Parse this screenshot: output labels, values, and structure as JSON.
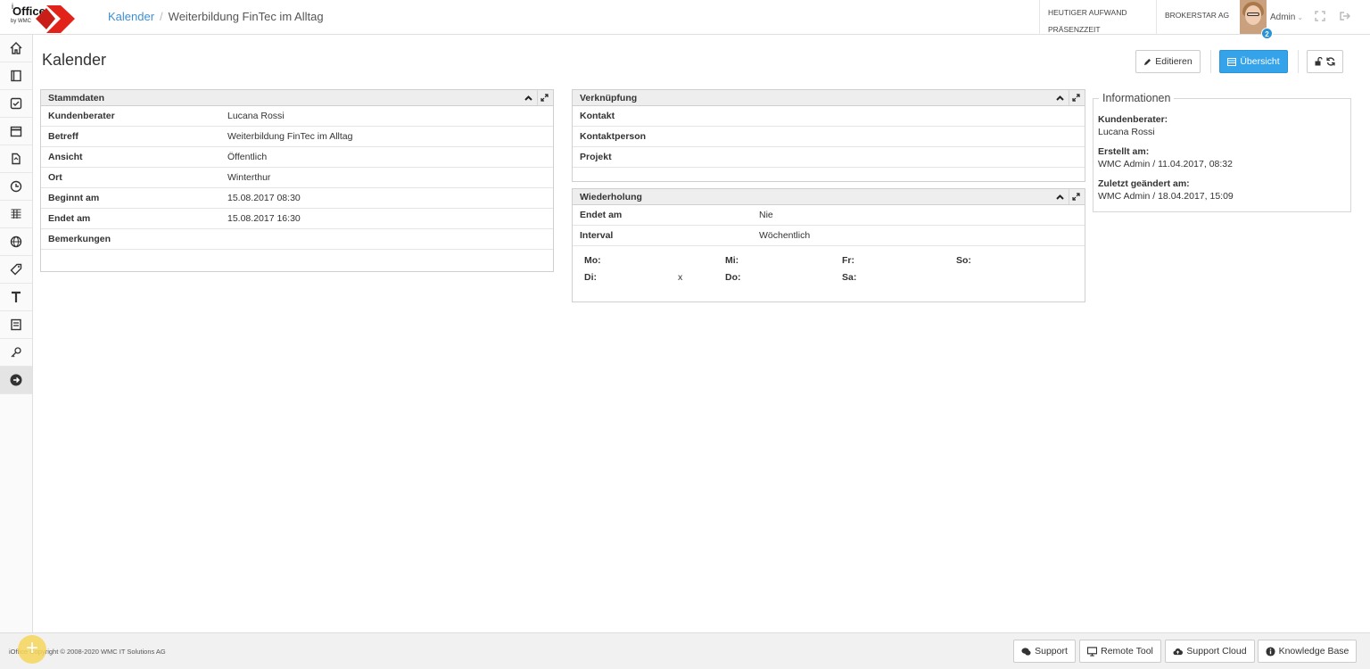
{
  "app": {
    "logo_word": "Office",
    "logo_i": "i",
    "logo_by": "by WMC"
  },
  "breadcrumb": {
    "parent": "Kalender",
    "current": "Weiterbildung FinTec im Alltag"
  },
  "top": {
    "stat1": "HEUTIGER AUFWAND",
    "stat2": "PRÄSENZZEIT",
    "company": "BROKERSTAR AG",
    "user": "Admin",
    "badge_count": "2"
  },
  "sidebar": {
    "items": [
      "home-icon",
      "book-icon",
      "checkbox-icon",
      "calendar-icon",
      "document-icon",
      "clock-icon",
      "table-icon",
      "globe-icon",
      "tag-icon",
      "text-icon",
      "form-icon",
      "key-icon",
      "arrow-right-icon"
    ],
    "active_index": 12
  },
  "page": {
    "title": "Kalender"
  },
  "toolbar": {
    "edit_label": "Editieren",
    "overview_label": "Übersicht"
  },
  "stammdaten": {
    "title": "Stammdaten",
    "rows": [
      {
        "k": "Kundenberater",
        "v": "Lucana Rossi"
      },
      {
        "k": "Betreff",
        "v": "Weiterbildung FinTec im Alltag"
      },
      {
        "k": "Ansicht",
        "v": "Öffentlich"
      },
      {
        "k": "Ort",
        "v": "Winterthur"
      },
      {
        "k": "Beginnt am",
        "v": "15.08.2017 08:30"
      },
      {
        "k": "Endet am",
        "v": "15.08.2017 16:30"
      },
      {
        "k": "Bemerkungen",
        "v": ""
      }
    ]
  },
  "verknuepfung": {
    "title": "Verknüpfung",
    "rows": [
      {
        "k": "Kontakt"
      },
      {
        "k": "Kontaktperson"
      },
      {
        "k": "Projekt"
      }
    ]
  },
  "wiederholung": {
    "title": "Wiederholung",
    "rows": [
      {
        "k": "Endet am",
        "v": "Nie"
      },
      {
        "k": "Interval",
        "v": "Wöchentlich"
      }
    ],
    "days": {
      "mo": "Mo:",
      "mo_v": "",
      "di": "Di:",
      "di_v": "x",
      "mi": "Mi:",
      "mi_v": "",
      "do": "Do:",
      "do_v": "",
      "fr": "Fr:",
      "fr_v": "",
      "sa": "Sa:",
      "sa_v": "",
      "so": "So:",
      "so_v": ""
    }
  },
  "informationen": {
    "title": "Informationen",
    "berater_label": "Kundenberater:",
    "berater_value": "Lucana Rossi",
    "erstellt_label": "Erstellt am:",
    "erstellt_value": "WMC Admin / 11.04.2017, 08:32",
    "geaendert_label": "Zuletzt geändert am:",
    "geaendert_value": "WMC Admin / 18.04.2017, 15:09"
  },
  "footer": {
    "copyright": "iOffice Copyright © 2008-2020 WMC IT Solutions AG",
    "support": "Support",
    "remote": "Remote Tool",
    "cloud": "Support Cloud",
    "kb": "Knowledge Base"
  },
  "colors": {
    "accent": "#35a3ea",
    "link": "#3d8fd4",
    "logo_red": "#e2231a"
  }
}
